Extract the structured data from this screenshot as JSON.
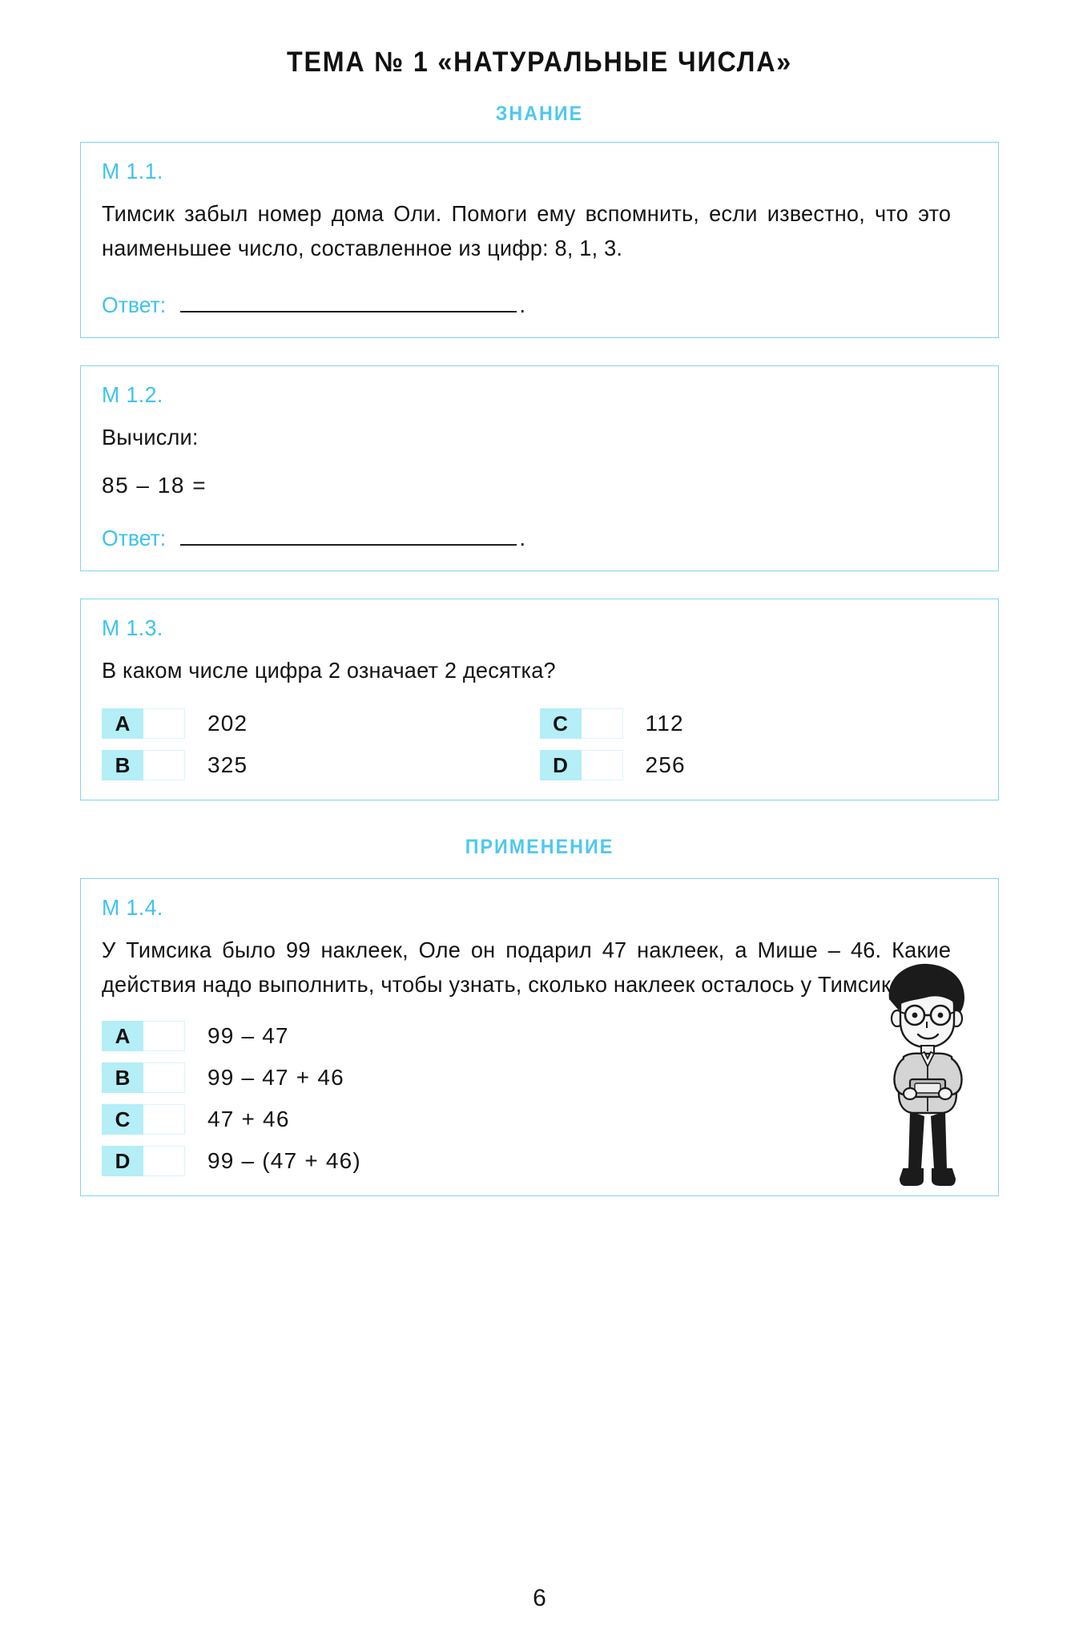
{
  "page": {
    "title": "ТЕМА № 1 «НАТУРАЛЬНЫЕ ЧИСЛА»",
    "number": "6",
    "accent_color": "#3fc3ee",
    "badge_color": "#b4eef6",
    "border_color": "#7fd5ef"
  },
  "sections": {
    "knowledge": "ЗНАНИЕ",
    "application": "ПРИМЕНЕНИЕ"
  },
  "answer_label": "Ответ:",
  "answer_period": ".",
  "tasks": [
    {
      "label": "М 1.1.",
      "text": "Тимсик забыл номер дома Оли. Помоги ему вспомнить, если известно, что это наименьшее число, составленное из цифр: 8, 1, 3."
    },
    {
      "label": "М 1.2.",
      "text": "Вычисли:",
      "calc": "85 – 18 ="
    },
    {
      "label": "М 1.3.",
      "text": "В каком числе цифра 2 означает 2 десятка?",
      "options": [
        {
          "letter": "A",
          "value": "202"
        },
        {
          "letter": "C",
          "value": "112"
        },
        {
          "letter": "B",
          "value": "325"
        },
        {
          "letter": "D",
          "value": "256"
        }
      ]
    },
    {
      "label": "М 1.4.",
      "text": "У Тимсика было 99 наклеек, Оле он подарил 47 наклеек, а Мише – 46. Какие действия надо выполнить, чтобы узнать, сколько наклеек осталось у Тимсика?",
      "options": [
        {
          "letter": "A",
          "value": "99 – 47"
        },
        {
          "letter": "B",
          "value": "99 – 47 + 46"
        },
        {
          "letter": "C",
          "value": "47 + 46"
        },
        {
          "letter": "D",
          "value": "99 – (47 + 46)"
        }
      ]
    }
  ]
}
